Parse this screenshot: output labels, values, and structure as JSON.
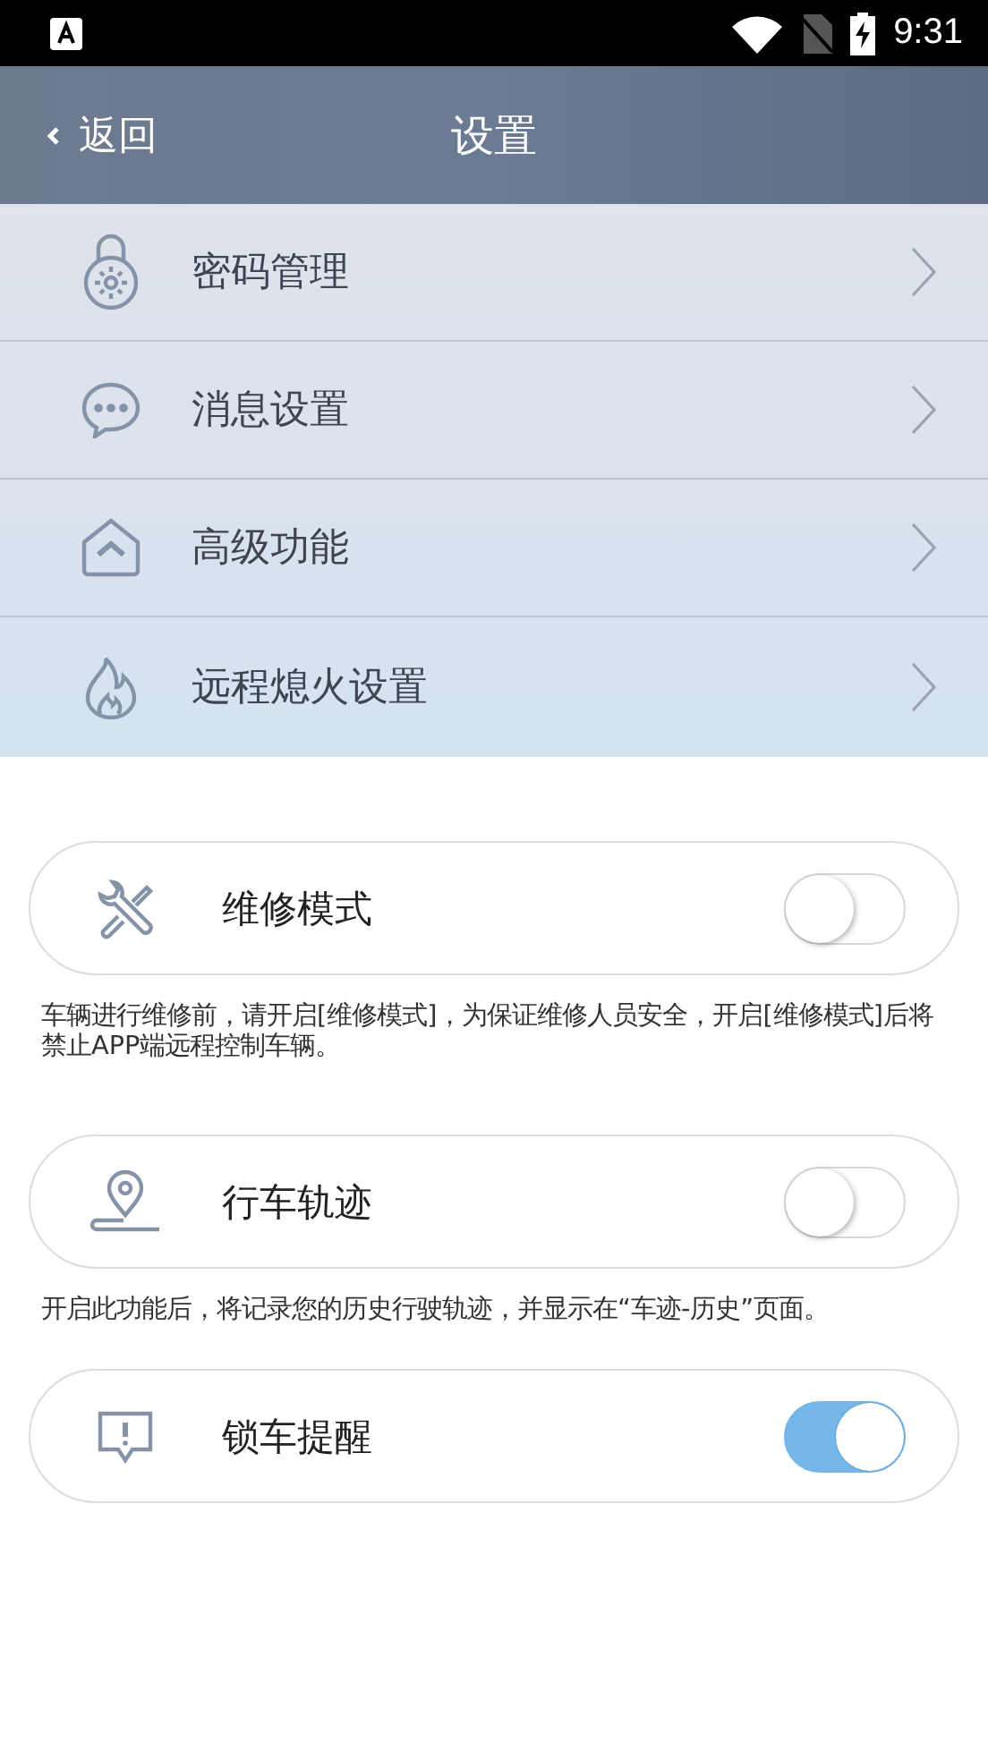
{
  "status_bar": {
    "time": "9:31"
  },
  "header": {
    "back": "返回",
    "title": "设置"
  },
  "menu": [
    {
      "label": "密码管理",
      "kind": "lock"
    },
    {
      "label": "消息设置",
      "kind": "chat"
    },
    {
      "label": "高级功能",
      "kind": "up"
    },
    {
      "label": "远程熄火设置",
      "kind": "flame"
    }
  ],
  "toggles": [
    {
      "label": "维修模式",
      "kind": "tools",
      "on": false,
      "note": "车辆进行维修前，请开启[维修模式]，为保证维修人员安全，开启[维修模式]后将禁止APP端远程控制车辆。"
    },
    {
      "label": "行车轨迹",
      "kind": "pin",
      "on": false,
      "note": "开启此功能后，将记录您的历史行驶轨迹，并显示在“车迹-历史”页面。"
    },
    {
      "label": "锁车提醒",
      "kind": "alert",
      "on": true
    }
  ]
}
